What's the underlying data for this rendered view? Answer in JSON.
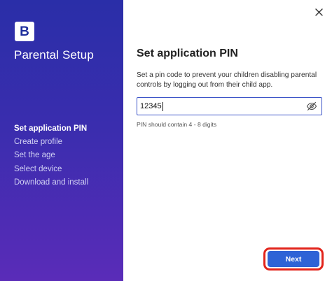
{
  "sidebar": {
    "logo_letter": "B",
    "title": "Parental Setup",
    "steps": [
      {
        "label": "Set application PIN",
        "active": true
      },
      {
        "label": "Create profile",
        "active": false
      },
      {
        "label": "Set the age",
        "active": false
      },
      {
        "label": "Select device",
        "active": false
      },
      {
        "label": "Download and install",
        "active": false
      }
    ]
  },
  "main": {
    "close_icon": "close-icon",
    "title": "Set application PIN",
    "description": "Set a pin code to prevent your children disabling parental controls by logging out from their child app.",
    "pin_input": {
      "value": "12345",
      "visibility_icon": "eye-off-icon"
    },
    "helper_text": "PIN should contain 4 - 8 digits",
    "next_label": "Next"
  },
  "colors": {
    "sidebar_gradient_top": "#2a2ea8",
    "sidebar_gradient_bottom": "#5a2cb8",
    "primary_button": "#2e63d6",
    "highlight_ring": "#e2241b",
    "input_border": "#3d55c8"
  }
}
